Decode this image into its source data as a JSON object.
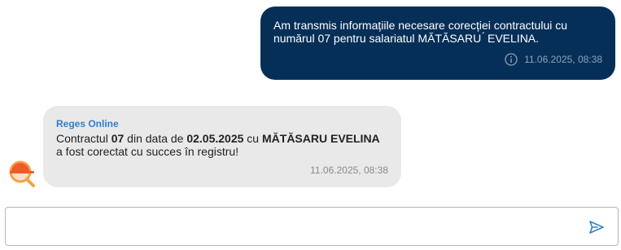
{
  "messages": {
    "outgoing": {
      "text": "Am transmis informațiile necesare corecției contractului cu numărul 07 pentru salariatul MĂTĂSARU  ́ EVELINA.",
      "timestamp": "11.06.2025, 08:38",
      "info_icon": "info-icon"
    },
    "incoming": {
      "sender": "Reges Online",
      "text_parts": {
        "p1": "Contractul ",
        "contract_no": "07",
        "p2": " din data de ",
        "date": "02.05.2025",
        "p3": " cu ",
        "name": "MĂTĂSARU EVELINA",
        "p4": " a fost corectat cu succes în registru!"
      },
      "timestamp": "11.06.2025, 08:38",
      "avatar_icon": "search-helmet-logo"
    }
  },
  "composer": {
    "placeholder": "",
    "value": "",
    "send_icon": "send-icon"
  },
  "colors": {
    "outgoing_bubble": "#062f58",
    "incoming_bubble": "#e9e9e9",
    "sender_name": "#2f80c8",
    "avatar_orange": "#f05a28",
    "send_icon": "#2f80c8"
  }
}
